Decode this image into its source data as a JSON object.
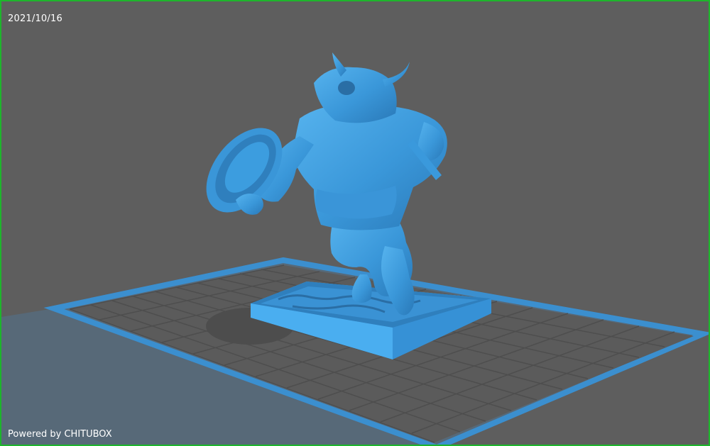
{
  "viewport": {
    "date_stamp": "2021/10/16",
    "footer_text": "Powered by CHITUBOX"
  },
  "colors": {
    "background": "#5e5e5e",
    "border": "#1db52c",
    "model": "#3d9ddf",
    "plate_outline": "#3b8fcf",
    "grid_line": "#525252"
  },
  "scene": {
    "model_name": "minotaur-figurine",
    "object": "3d-model-on-build-plate"
  }
}
